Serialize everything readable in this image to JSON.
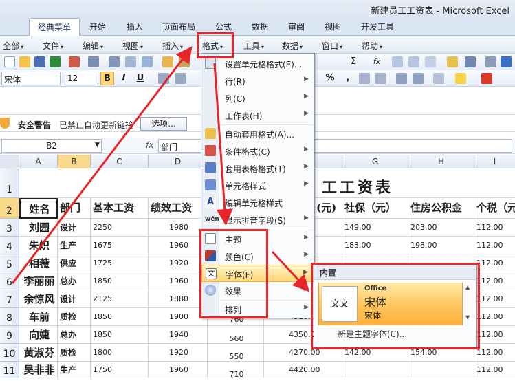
{
  "app": {
    "title": "新建员工工资表 - Microsoft Excel"
  },
  "tabs": [
    "经典菜单",
    "开始",
    "插入",
    "页面布局",
    "公式",
    "数据",
    "审阅",
    "视图",
    "开发工具"
  ],
  "menubar": [
    "全部",
    "文件",
    "编辑",
    "视图",
    "插入",
    "格式",
    "工具",
    "数据",
    "窗口",
    "帮助"
  ],
  "toolbar": {
    "font_name": "宋体",
    "font_size": "12",
    "bold": "B",
    "italic": "I",
    "underline": "U",
    "percent": "%",
    "comma": ",",
    "sum": "Σ",
    "fx": "fx"
  },
  "security": {
    "label": "安全警告",
    "message": "已禁止自动更新链接",
    "options_button": "选项..."
  },
  "formula_bar": {
    "name_box": "B2",
    "fx": "fx",
    "value": "部门"
  },
  "columns": [
    "A",
    "B",
    "C",
    "D",
    "E",
    "F",
    "G",
    "H",
    "I"
  ],
  "rows": [
    "1",
    "2",
    "3",
    "4",
    "5",
    "6",
    "7",
    "8",
    "9",
    "10",
    "11"
  ],
  "sheet": {
    "title": "工工资表",
    "headers": [
      "姓名",
      "部门",
      "基本工资",
      "绩效工资",
      "(元)",
      "社保（元）",
      "住房公积金",
      "个税（元"
    ],
    "data": [
      {
        "name": "刘园",
        "dept": "设计",
        "base": "2250",
        "perf": "1980",
        "e": "",
        "f": "",
        "g": "149.00",
        "h": "203.00",
        "i": "112.00"
      },
      {
        "name": "朱炽",
        "dept": "生产",
        "base": "1675",
        "perf": "1960",
        "e": "",
        "f": "",
        "g": "183.00",
        "h": "198.00",
        "i": "112.00"
      },
      {
        "name": "相薇",
        "dept": "供应",
        "base": "1725",
        "perf": "1920",
        "e": "",
        "f": "",
        "g": "",
        "h": "",
        "i": "112.00"
      },
      {
        "name": "李丽丽",
        "dept": "总办",
        "base": "1850",
        "perf": "1960",
        "e": "",
        "f": "",
        "g": "",
        "h": "",
        "i": "112.00"
      },
      {
        "name": "余惊风",
        "dept": "设计",
        "base": "2125",
        "perf": "1880",
        "e": "",
        "f": "",
        "g": "",
        "h": "",
        "i": "112.00"
      },
      {
        "name": "车前",
        "dept": "质检",
        "base": "1850",
        "perf": "1900",
        "e": "760",
        "f": "4510.",
        "g": "",
        "h": "",
        "i": "112.00"
      },
      {
        "name": "向婕",
        "dept": "总办",
        "base": "1850",
        "perf": "1940",
        "e": "560",
        "f": "4350.00",
        "g": "",
        "h": "",
        "i": "112.00"
      },
      {
        "name": "黄淑芬",
        "dept": "质检",
        "base": "1800",
        "perf": "1920",
        "e": "550",
        "f": "4270.00",
        "g": "142.00",
        "h": "154.00",
        "i": "112.00"
      },
      {
        "name": "吴非非",
        "dept": "生产",
        "base": "1750",
        "perf": "1960",
        "e": "710",
        "f": "4420.00",
        "g": "",
        "h": "",
        "i": "112.00"
      }
    ]
  },
  "format_menu": {
    "items": [
      {
        "label": "设置单元格格式(E)...",
        "sub": "",
        "icon": "format-cells-icon"
      },
      {
        "label": "行(R)",
        "sub": "▶",
        "icon": ""
      },
      {
        "label": "列(C)",
        "sub": "▶",
        "icon": ""
      },
      {
        "label": "工作表(H)",
        "sub": "▶",
        "icon": ""
      },
      {
        "label": "自动套用格式(A)...",
        "sub": "",
        "icon": "autoformat-icon"
      },
      {
        "label": "条件格式(C)",
        "sub": "▶",
        "icon": "conditional-format-icon"
      },
      {
        "label": "套用表格格式(T)",
        "sub": "▶",
        "icon": "table-style-icon"
      },
      {
        "label": "单元格样式",
        "sub": "▶",
        "icon": "cell-style-icon"
      },
      {
        "label": "编辑单元格样式",
        "sub": "",
        "icon": "edit-style-icon"
      },
      {
        "label": "显示拼音字段(S)",
        "sub": "▶",
        "icon": "phonetic-icon"
      },
      {
        "label": "主题",
        "sub": "▶",
        "icon": "theme-icon"
      },
      {
        "label": "颜色(C)",
        "sub": "▶",
        "icon": "color-icon"
      },
      {
        "label": "字体(F)",
        "sub": "▶",
        "icon": "font-icon"
      },
      {
        "label": "效果",
        "sub": "▶",
        "icon": "effects-icon"
      },
      {
        "label": "排列",
        "sub": "▶",
        "icon": ""
      }
    ]
  },
  "font_submenu": {
    "section": "内置",
    "option": {
      "title": "Office",
      "heading_font": "宋体",
      "body_font": "宋体",
      "swatch": "文文"
    },
    "new_theme_font": "新建主题字体(C)..."
  },
  "colors": {
    "highlight_red": "#e8262a",
    "ribbon": "#dbe6f5"
  }
}
